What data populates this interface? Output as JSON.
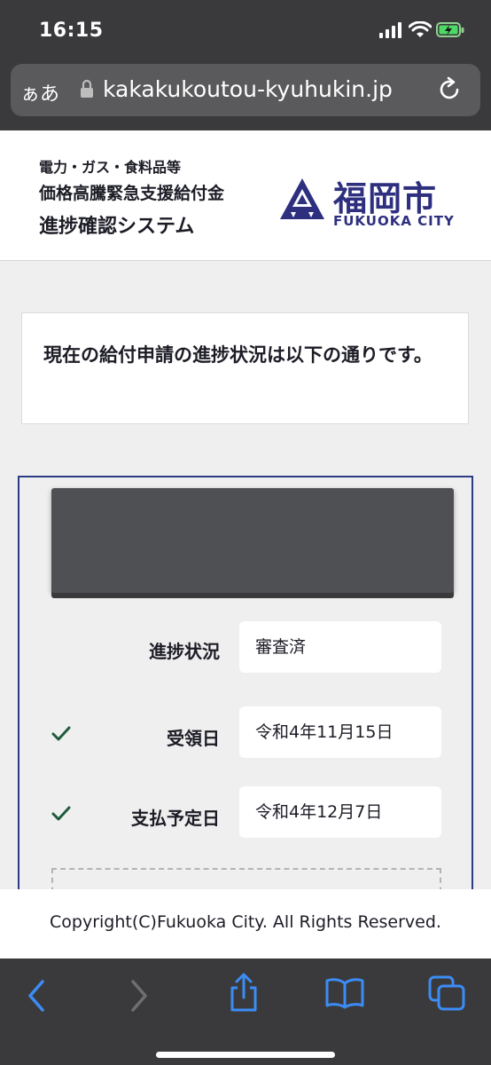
{
  "status_bar": {
    "time": "16:15",
    "signal_icon": "signal-bars-icon",
    "wifi_icon": "wifi-icon",
    "battery_icon": "battery-charging-icon"
  },
  "browser": {
    "text_size_label": "ぁあ",
    "url": "kakakukoutou-kyuhukin.jp",
    "lock_icon": "lock-icon",
    "reload_icon": "reload-icon"
  },
  "header": {
    "line1": "電力・ガス・食料品等",
    "line2": "価格高騰緊急支援給付金",
    "line3": "進捗確認システム",
    "logo_jp": "福岡市",
    "logo_en": "FUKUOKA CITY",
    "brand_color": "#2e2f7f"
  },
  "notice": {
    "text": "現在の給付申請の進捗状況は以下の通りです。"
  },
  "status_card": {
    "border_color": "#2c3d86",
    "rows": [
      {
        "label": "進捗状況",
        "value": "審査済",
        "checked": false
      },
      {
        "label": "受領日",
        "value": "令和4年11月15日",
        "checked": true
      },
      {
        "label": "支払予定日",
        "value": "令和4年12月7日",
        "checked": true
      }
    ],
    "check_color": "#1e5c3a"
  },
  "footer": {
    "copyright": "Copyright(C)Fukuoka City. All Rights Reserved."
  },
  "toolbar": {
    "back_icon": "back-arrow-icon",
    "forward_icon": "forward-arrow-icon",
    "share_icon": "share-icon",
    "bookmarks_icon": "book-icon",
    "tabs_icon": "tabs-icon",
    "accent_color": "#3c8cf5"
  }
}
